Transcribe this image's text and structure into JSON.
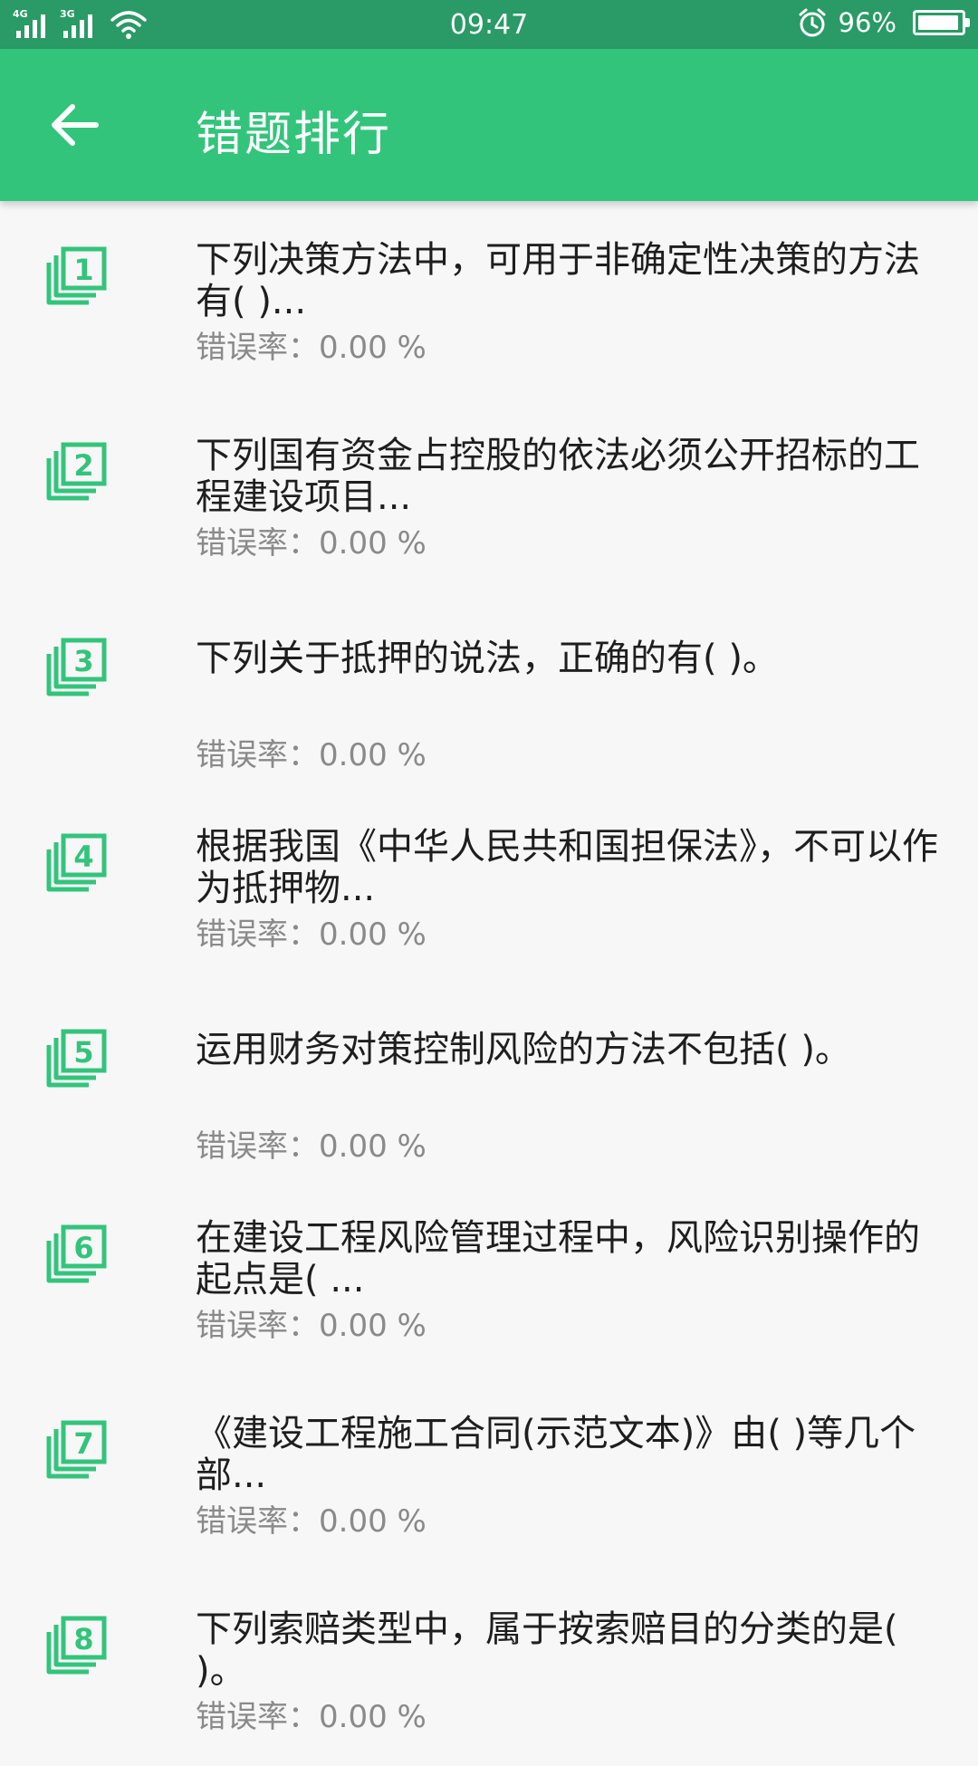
{
  "status_bar": {
    "net1": "4G",
    "net2": "3G",
    "time": "09:47",
    "battery": "96%",
    "battery_level": 0.96
  },
  "header": {
    "title": "错题排行"
  },
  "rate_label": "错误率：",
  "items": [
    {
      "rank": "1",
      "title": "下列决策方法中，可用于非确定性决策的方法有(  )...",
      "rate": "0.00 %"
    },
    {
      "rank": "2",
      "title": "下列国有资金占控股的依法必须公开招标的工程建设项目...",
      "rate": "0.00 %"
    },
    {
      "rank": "3",
      "title": "下列关于抵押的说法，正确的有(  )。",
      "rate": "0.00 %"
    },
    {
      "rank": "4",
      "title": "根据我国《中华人民共和国担保法》，不可以作为抵押物...",
      "rate": "0.00 %"
    },
    {
      "rank": "5",
      "title": "运用财务对策控制风险的方法不包括(  )。",
      "rate": "0.00 %"
    },
    {
      "rank": "6",
      "title": "在建设工程风险管理过程中，风险识别操作的起点是( ...",
      "rate": "0.00 %"
    },
    {
      "rank": "7",
      "title": "《建设工程施工合同(示范文本)》由(  )等几个部...",
      "rate": "0.00 %"
    },
    {
      "rank": "8",
      "title": "下列索赔类型中，属于按索赔目的分类的是(  )。",
      "rate": "0.00 %"
    }
  ],
  "colors": {
    "status_bar": "#2a9a66",
    "toolbar": "#33c47c",
    "icon": "#33c47c",
    "rate_text": "#8a8a8a"
  }
}
